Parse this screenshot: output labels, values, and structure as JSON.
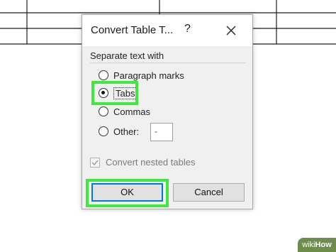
{
  "dialog": {
    "title": "Convert Table T...",
    "help_glyph": "?",
    "group_label": "Separate text with",
    "options": [
      {
        "label": "Paragraph marks",
        "checked": false
      },
      {
        "label": "Tabs",
        "checked": true
      },
      {
        "label": "Commas",
        "checked": false
      },
      {
        "label": "Other:",
        "checked": false
      }
    ],
    "other_value": "-",
    "nested_label": "Convert nested tables",
    "nested_checked": true,
    "ok_label": "OK",
    "cancel_label": "Cancel"
  },
  "highlight_color": "#3ee83e",
  "watermark": {
    "wiki": "wiki",
    "how": "How"
  }
}
